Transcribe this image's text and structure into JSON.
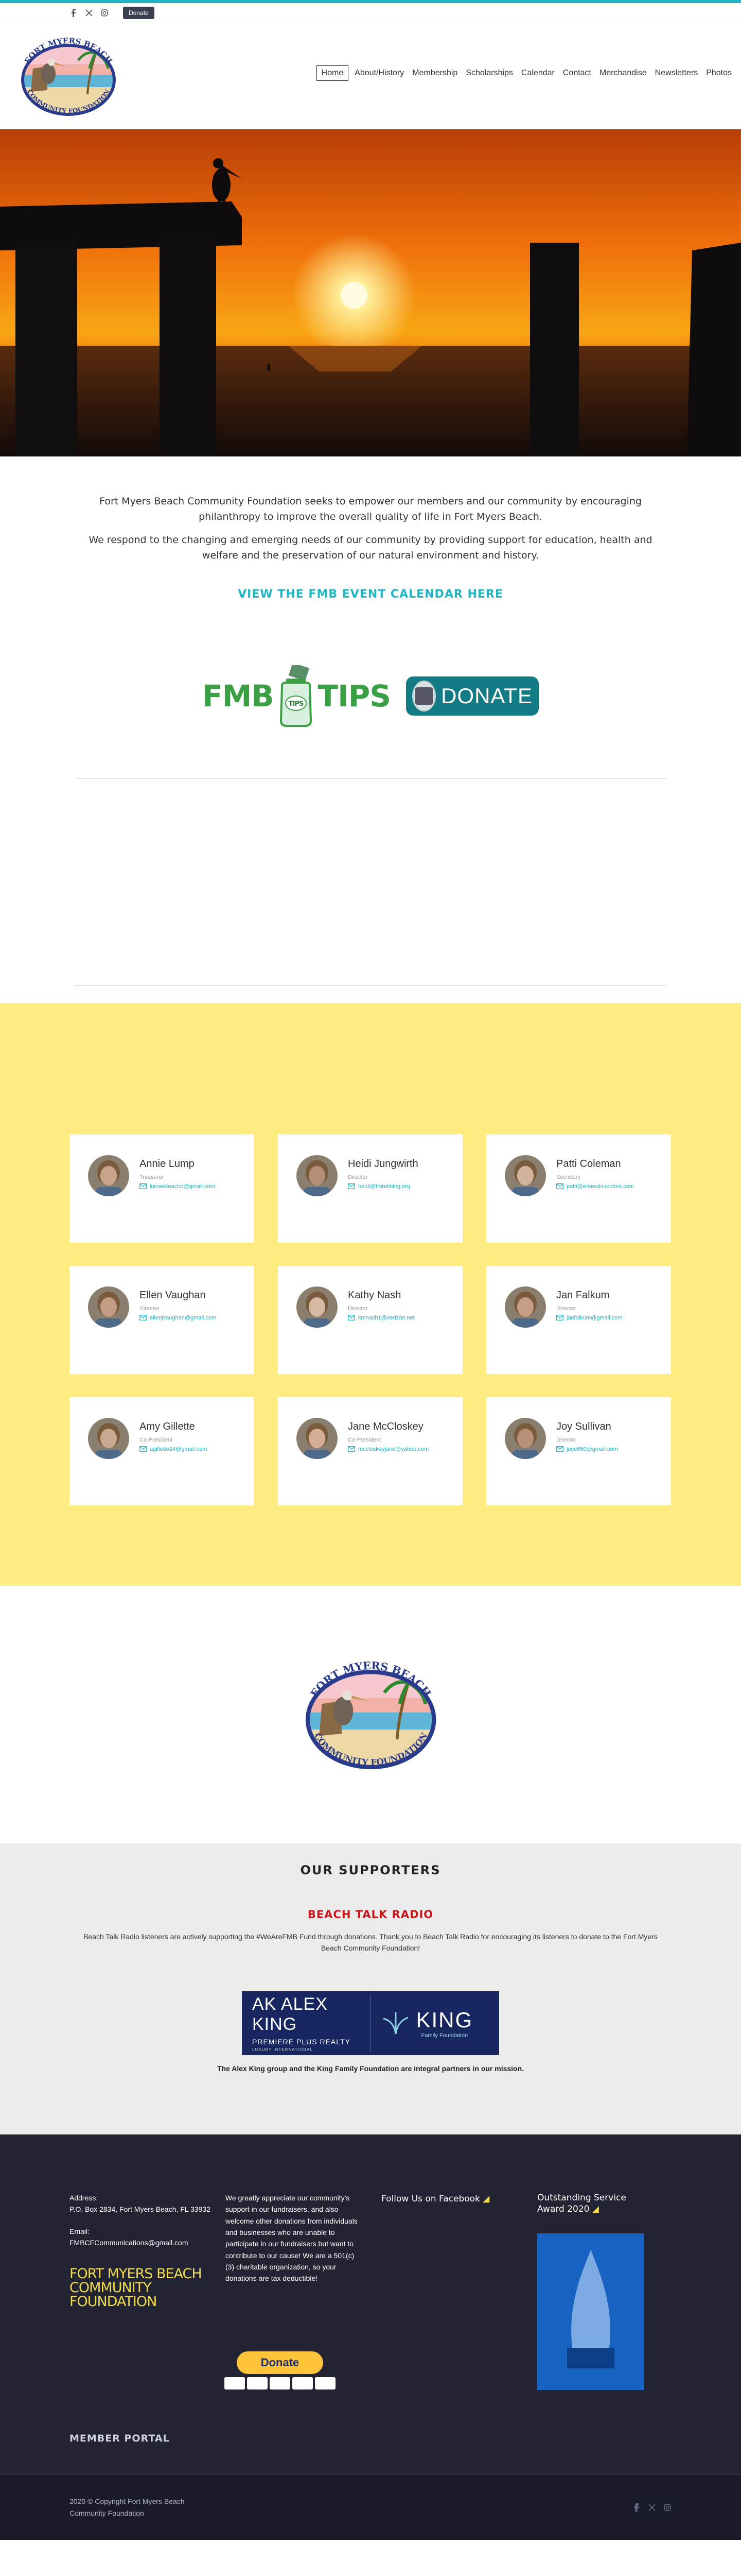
{
  "topbar": {
    "social": [
      "facebook-icon",
      "x-icon",
      "instagram-icon"
    ],
    "donate_label": "Donate"
  },
  "nav": [
    "Home",
    "About/History",
    "Membership",
    "Scholarships",
    "Calendar",
    "Contact",
    "Merchandise",
    "Newsletters",
    "Photos"
  ],
  "logo": {
    "arc_top": "FORT MYERS BEACH",
    "arc_bottom": "COMMUNITY FOUNDATION"
  },
  "mission": {
    "p1": "Fort Myers Beach Community Foundation seeks to empower our members and our community by encouraging philanthropy to improve the overall quality of life in Fort Myers Beach.",
    "p2": "We respond to the changing and emerging needs of our community by providing support for education, health and welfare and the preservation of our natural environment and history.",
    "calendar_link": "VIEW THE FMB EVENT CALENDAR HERE"
  },
  "badges": {
    "fmb": "FMB",
    "tips": "TIPS",
    "jar_label": "TIPS",
    "donate": "DONATE"
  },
  "board": [
    {
      "name": "Annie Lump",
      "role": "Treasurer",
      "email": "lumaekoacho@gmail.com"
    },
    {
      "name": "Heidi Jungwirth",
      "role": "Director",
      "email": "heidi@fmbdining.org"
    },
    {
      "name": "Patti Coleman",
      "role": "Secretary",
      "email": "patti@emeraldvectors.com"
    },
    {
      "name": "Ellen Vaughan",
      "role": "Director",
      "email": "ellenjvaughan@gmail.com"
    },
    {
      "name": "Kathy Nash",
      "role": "Director",
      "email": "kmnash1@verizon.net"
    },
    {
      "name": "Jan Falkum",
      "role": "Director",
      "email": "janfalkum@gmail.com"
    },
    {
      "name": "Amy Gillette",
      "role": "Co-President",
      "email": "agillette24@gmail.com"
    },
    {
      "name": "Jane McCloskey",
      "role": "Co-President",
      "email": "mccloskeyjane@yahoo.com"
    },
    {
      "name": "Joy Sullivan",
      "role": "Director",
      "email": "joye650@gmail.com"
    }
  ],
  "supporters": {
    "heading": "OUR SUPPORTERS",
    "radio": "BEACH TALK RADIO",
    "blurb": "Beach Talk Radio listeners are actively supporting the #WeAreFMB Fund through donations.  Thank you to Beach Talk Radio for encouraging its listeners to donate to the Fort Myers Beach Community Foundation!",
    "ak": "ALEX KING",
    "ak_logo": "AK",
    "ppr": "PREMIERE PLUS REALTY",
    "li": "LUXURY INTERNATIONAL",
    "king": "KING",
    "family": "Family Foundation",
    "partners": "The Alex King group and the King Family Foundation are integral partners in our mission."
  },
  "footer": {
    "address_label": "Address:",
    "address": "P.O. Box 2834, Fort Myers Beach, FL 33932",
    "email_label": "Email:",
    "email": "FMBCFCommunications@gmail.com",
    "name_line1": "FORT MYERS BEACH",
    "name_line2": "COMMUNITY FOUNDATION",
    "thanks": "We greatly appreciate our community's support in our fundraisers, and also welcome other donations from individuals and businesses who are unable to participate in our fundraisers but want to contribute to our cause! We are a 501(c)(3) charitable organization, so your donations are tax deductible!",
    "follow": "Follow Us on Facebook",
    "award_title": "Outstanding Service Award 2020",
    "paypal": "Donate",
    "member_portal": "MEMBER PORTAL",
    "copyright": "2020 © Copyright Fort Myers Beach Community Foundation"
  },
  "colors": {
    "accent": "#1fb5c4",
    "board_bg": "#ffec81",
    "footer_bg": "#222434",
    "footer_title": "#f2dc4a",
    "red": "#c8161d"
  }
}
